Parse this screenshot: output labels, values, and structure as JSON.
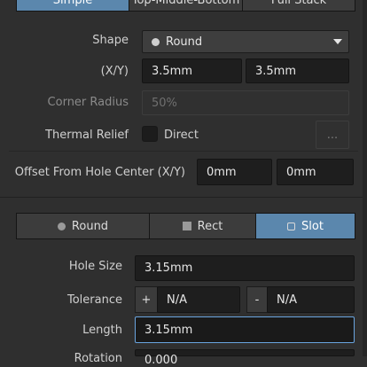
{
  "tabs": [
    "Simple",
    "Top-Middle-Bottom",
    "Full Stack"
  ],
  "shape": {
    "label": "Shape",
    "value": "Round"
  },
  "xy": {
    "label": "(X/Y)",
    "x": "3.5mm",
    "y": "3.5mm"
  },
  "corner_radius": {
    "label": "Corner Radius",
    "placeholder": "50%"
  },
  "thermal_relief": {
    "label": "Thermal Relief",
    "option": "Direct",
    "more": "..."
  },
  "offset": {
    "label": "Offset From Hole Center (X/Y)",
    "x": "0mm",
    "y": "0mm"
  },
  "hole_shapes": [
    "Round",
    "Rect",
    "Slot"
  ],
  "hole_size": {
    "label": "Hole Size",
    "value": "3.15mm"
  },
  "tolerance": {
    "label": "Tolerance",
    "plus": "+",
    "plus_value": "N/A",
    "minus": "-",
    "minus_value": "N/A"
  },
  "length": {
    "label": "Length",
    "value": "3.15mm"
  },
  "rotation": {
    "label": "Rotation",
    "value": "0.000"
  },
  "colors": {
    "accent": "#5b87ad",
    "focus": "#6aa5e0",
    "panel": "#2f2f2f",
    "field": "#1e1e1e"
  }
}
